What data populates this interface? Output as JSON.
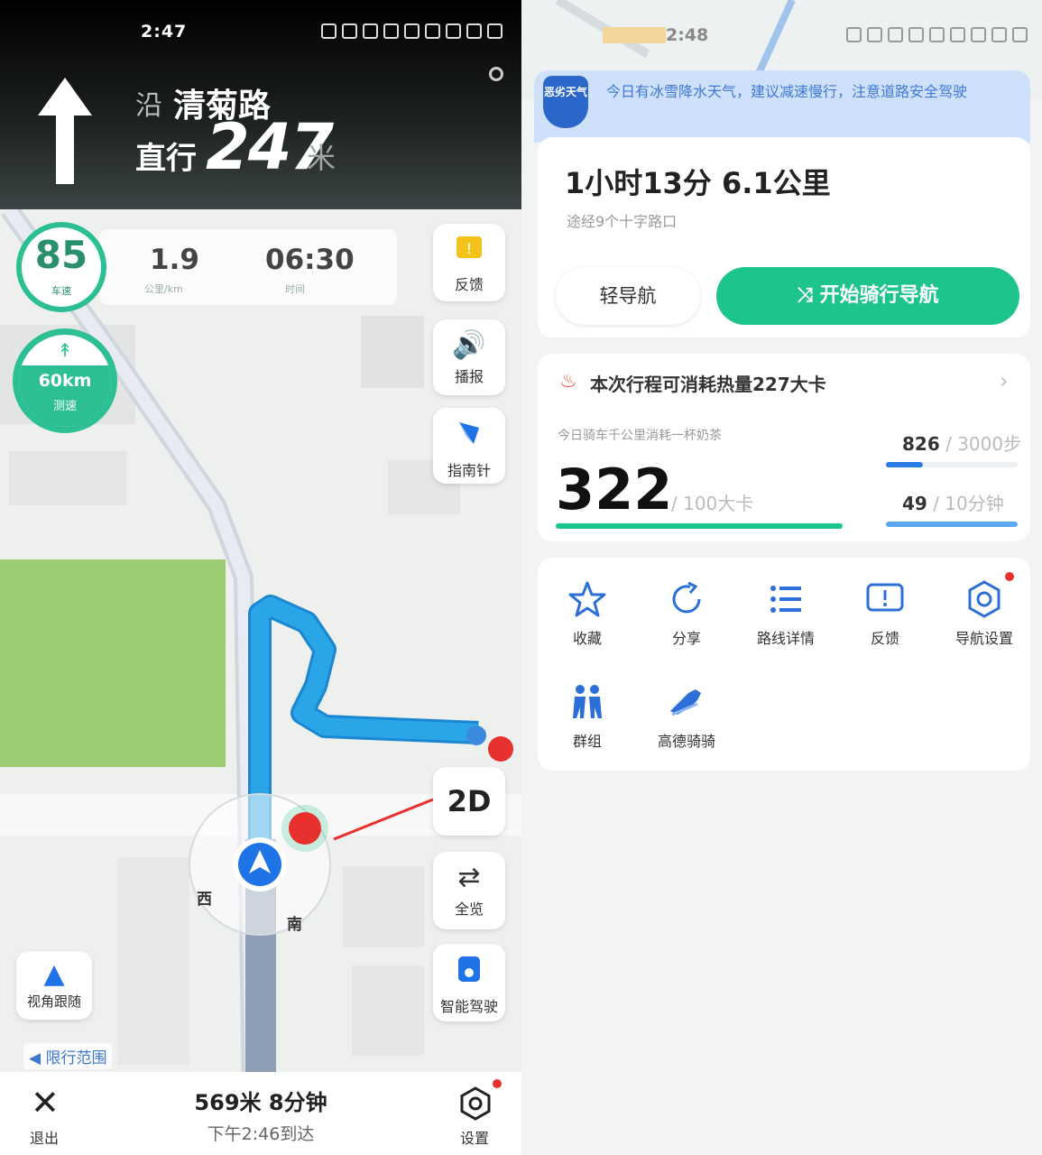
{
  "left": {
    "status_time": "2:47",
    "header": {
      "along_prefix": "沿",
      "road_name": "清菊路",
      "action": "直行",
      "distance": "247",
      "distance_unit": "米"
    },
    "speed_limit": {
      "value": "85",
      "label": "车速"
    },
    "info": [
      {
        "value": "1.9",
        "label": "公里/km"
      },
      {
        "value": "06:30",
        "label": "时间"
      }
    ],
    "camera": {
      "top": "↟",
      "value": "60km",
      "label": "测速"
    },
    "side_buttons": [
      {
        "icon": "report-icon",
        "label": "反馈"
      },
      {
        "icon": "speaker-icon",
        "label": "播报"
      },
      {
        "icon": "compass-icon",
        "label": "指南针"
      }
    ],
    "mode_2d": "2D",
    "side_buttons_lower": [
      {
        "icon": "route-overview-icon",
        "label": "全览"
      },
      {
        "icon": "smart-icon",
        "label": "智能驾驶"
      }
    ],
    "view_follow_label": "视角跟随",
    "restricted_label": "◀ 限行范围",
    "map_labels": [
      "西",
      "南"
    ],
    "bottom": {
      "exit_label": "退出",
      "remaining": "569米 8分钟",
      "arrival": "下午2:46到达",
      "settings_label": "设置"
    }
  },
  "right": {
    "status_time": "2:48",
    "weather": {
      "badge": "恶劣天气",
      "text": "今日有冰雪降水天气，建议减速慢行，注意道路安全驾驶"
    },
    "route": {
      "duration": "1小时13分 6.1公里",
      "via": "途经9个十字路口",
      "light_nav_label": "轻导航",
      "start_label": "开始骑行导航"
    },
    "calorie": {
      "title": "本次行程可消耗热量227大卡",
      "subtitle": "今日骑车千公里消耗一杯奶茶",
      "value": "322",
      "target": "/ 100大卡",
      "stat1_value": "826",
      "stat1_target": " / 3000步",
      "stat2_value": "49",
      "stat2_target": " / 10分钟",
      "progress_main": 1.0,
      "progress_stat1": 0.28,
      "progress_stat2": 1.0
    },
    "tools": [
      {
        "icon": "star-icon",
        "label": "收藏"
      },
      {
        "icon": "share-icon",
        "label": "分享"
      },
      {
        "icon": "list-icon",
        "label": "路线详情"
      },
      {
        "icon": "feedback-icon",
        "label": "反馈"
      },
      {
        "icon": "settings-icon",
        "label": "导航设置"
      },
      {
        "icon": "group-icon",
        "label": "群组"
      },
      {
        "icon": "shoe-icon",
        "label": "高德骑骑"
      }
    ]
  },
  "colors": {
    "accent_green": "#1ec48e",
    "route_blue": "#2aa6e8",
    "weather_blue": "#3f79d6"
  }
}
